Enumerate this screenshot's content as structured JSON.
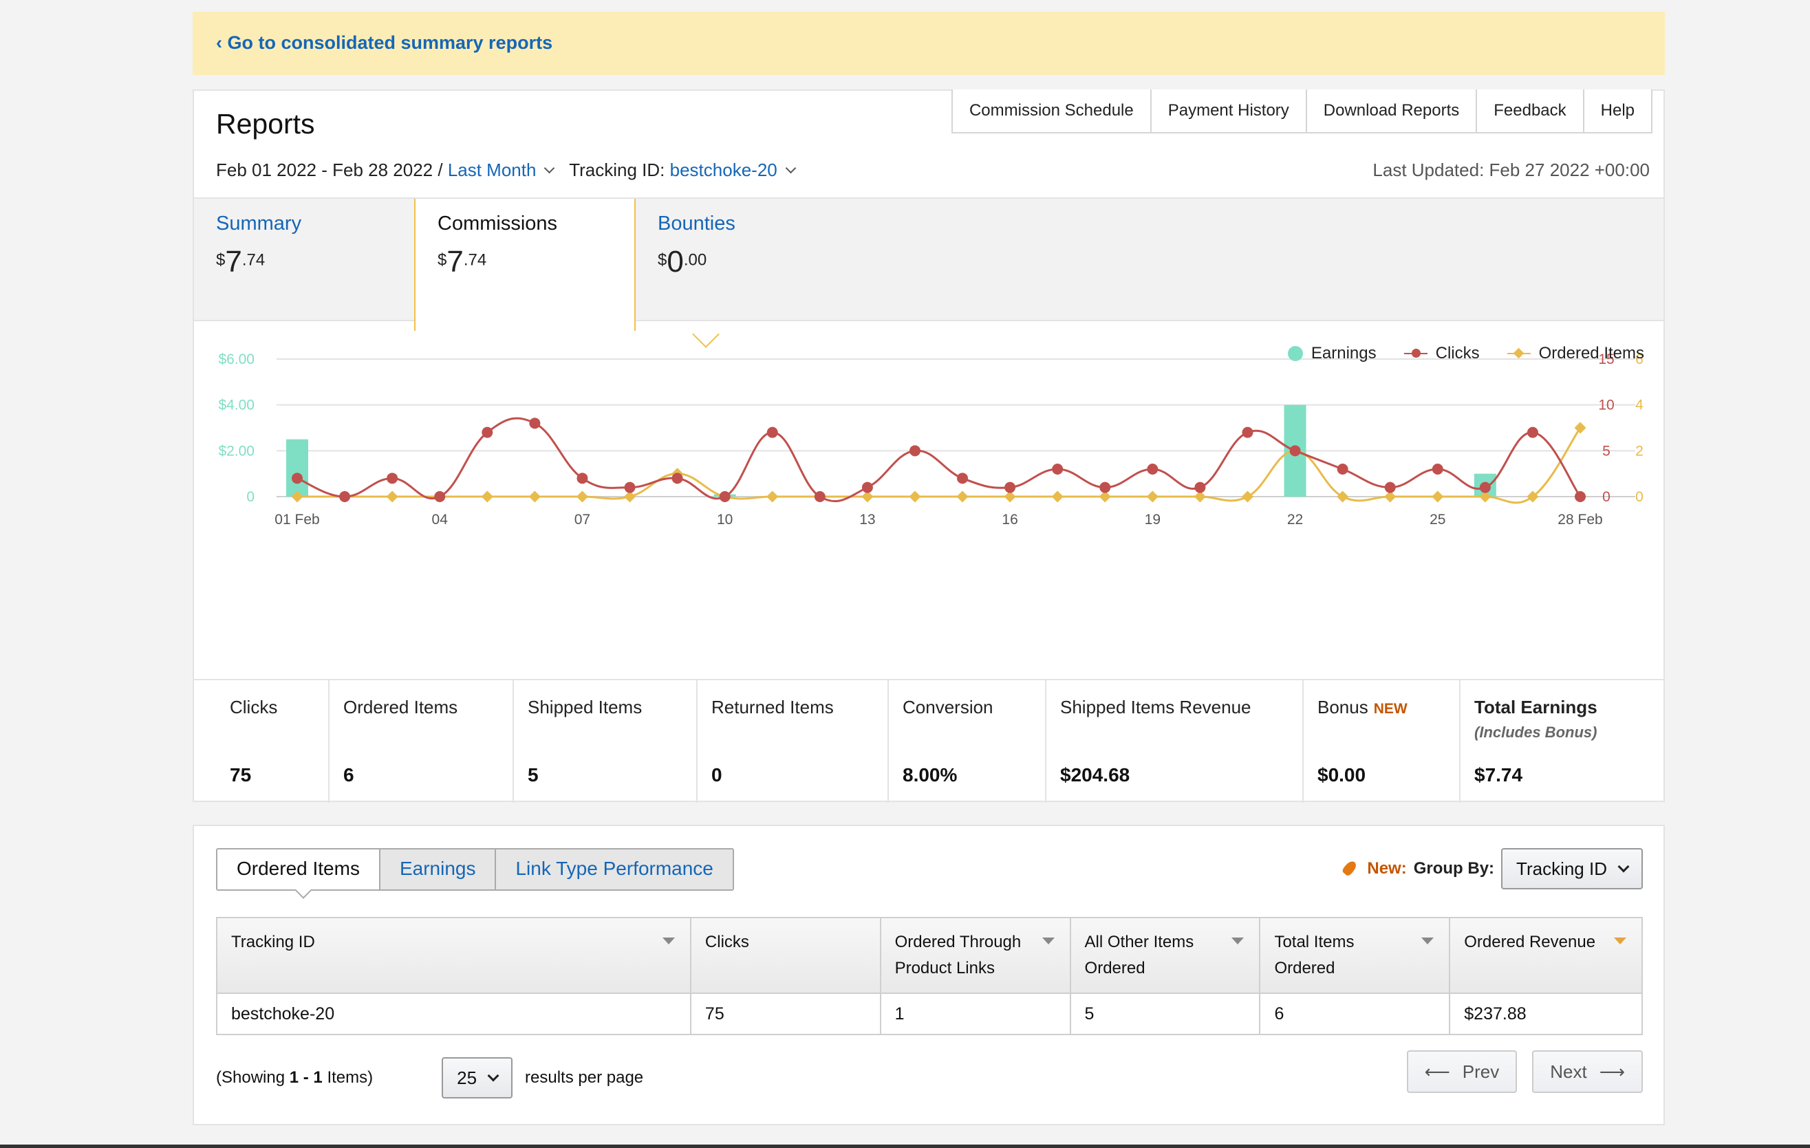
{
  "banner": {
    "link": "‹ Go to consolidated summary reports"
  },
  "header": {
    "title": "Reports",
    "nav": [
      "Commission Schedule",
      "Payment History",
      "Download Reports",
      "Feedback",
      "Help"
    ],
    "date_range": "Feb 01 2022 - Feb 28 2022 /",
    "period": "Last Month",
    "tracking_label": "Tracking ID:",
    "tracking_id": "bestchoke-20",
    "last_updated": "Last Updated: Feb 27 2022 +00:00"
  },
  "tabs": [
    {
      "label": "Summary",
      "currency": "$",
      "dollars": "7",
      "cents": ".74"
    },
    {
      "label": "Commissions",
      "currency": "$",
      "dollars": "7",
      "cents": ".74"
    },
    {
      "label": "Bounties",
      "currency": "$",
      "dollars": "0",
      "cents": ".00"
    }
  ],
  "chart_data": {
    "type": "bar+line",
    "legend": [
      "Earnings",
      "Clicks",
      "Ordered Items"
    ],
    "legend_position": "top-right",
    "x_ticks": [
      "01 Feb",
      "04",
      "07",
      "10",
      "13",
      "16",
      "19",
      "22",
      "25",
      "28 Feb"
    ],
    "y_left": {
      "ticks": [
        "0",
        "$2.00",
        "$4.00",
        "$6.00"
      ],
      "range": [
        0,
        6
      ]
    },
    "y_right_clicks": {
      "ticks": [
        "0",
        "5",
        "10",
        "15"
      ],
      "range": [
        0,
        15
      ]
    },
    "y_right_items": {
      "ticks": [
        "0",
        "2",
        "4",
        "6"
      ],
      "range": [
        0,
        6
      ]
    },
    "days": [
      1,
      2,
      3,
      4,
      5,
      6,
      7,
      8,
      9,
      10,
      11,
      12,
      13,
      14,
      15,
      16,
      17,
      18,
      19,
      20,
      21,
      22,
      23,
      24,
      25,
      26,
      27,
      28
    ],
    "series": [
      {
        "name": "Earnings",
        "type": "bar",
        "values": [
          2.5,
          0,
          0,
          0,
          0,
          0,
          0,
          0,
          0,
          0.1,
          0,
          0,
          0,
          0,
          0,
          0,
          0,
          0,
          0,
          0,
          0,
          4.0,
          0,
          0,
          0,
          1.0,
          0,
          0
        ]
      },
      {
        "name": "Clicks",
        "type": "line",
        "values": [
          2,
          0,
          2,
          0,
          7,
          8,
          2,
          1,
          2,
          0,
          7,
          0,
          1,
          5,
          2,
          1,
          3,
          1,
          3,
          1,
          7,
          5,
          3,
          1,
          3,
          1,
          7,
          0
        ]
      },
      {
        "name": "Ordered Items",
        "type": "line",
        "values": [
          0,
          0,
          0,
          0,
          0,
          0,
          0,
          0,
          1,
          0,
          0,
          0,
          0,
          0,
          0,
          0,
          0,
          0,
          0,
          0,
          0,
          2,
          0,
          0,
          0,
          0,
          0,
          3
        ]
      }
    ],
    "grid": true
  },
  "stats": [
    {
      "label": "Clicks",
      "value": "75"
    },
    {
      "label": "Ordered Items",
      "value": "6"
    },
    {
      "label": "Shipped Items",
      "value": "5"
    },
    {
      "label": "Returned Items",
      "value": "0"
    },
    {
      "label": "Conversion",
      "value": "8.00%"
    },
    {
      "label": "Shipped Items Revenue",
      "value": "$204.68"
    },
    {
      "label": "Bonus",
      "badge": "NEW",
      "value": "$0.00"
    },
    {
      "label": "Total Earnings",
      "sub": "(Includes Bonus)",
      "value": "$7.74"
    }
  ],
  "subtabs": [
    "Ordered Items",
    "Earnings",
    "Link Type Performance"
  ],
  "groupby": {
    "new": "New:",
    "label": "Group By:",
    "value": "Tracking ID"
  },
  "table": {
    "headers": [
      "Tracking ID",
      "Clicks",
      "Ordered Through Product Links",
      "All Other Items Ordered",
      "Total Items Ordered",
      "Ordered Revenue"
    ],
    "rows": [
      [
        "bestchoke-20",
        "75",
        "1",
        "5",
        "6",
        "$237.88"
      ]
    ]
  },
  "pager": {
    "showing_pre": "(Showing",
    "showing_range": "1 - 1",
    "showing_post": "Items)",
    "per_page": "25",
    "per_page_label": "results per page",
    "prev": "Prev",
    "next": "Next"
  },
  "colors": {
    "earnings": "#7fdfc4",
    "clicks": "#c0504d",
    "ordered_items": "#e8bb4a",
    "link": "#1566b7",
    "banner": "#fcedb7"
  }
}
